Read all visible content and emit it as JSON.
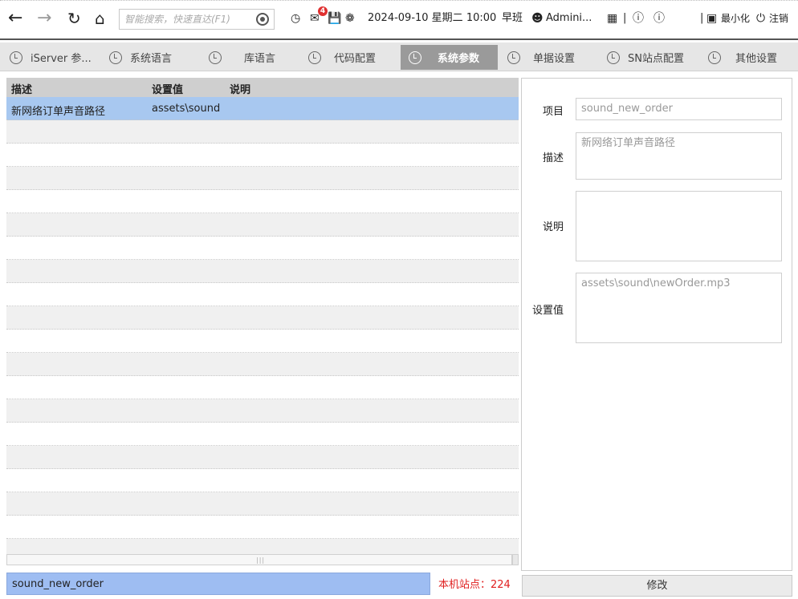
{
  "toolbar": {
    "search_placeholder": "智能搜索，快速直达(F1)",
    "mail_badge": "4",
    "datetime": "2024-09-10 星期二 10:00",
    "shift": "早班",
    "user": "Admini...",
    "minimize_label": "最小化",
    "logout_label": "注销"
  },
  "tabs": [
    {
      "label": "iServer 参...",
      "active": false
    },
    {
      "label": "系统语言",
      "active": false
    },
    {
      "label": "库语言",
      "active": false
    },
    {
      "label": "代码配置",
      "active": false
    },
    {
      "label": "系统参数",
      "active": true
    },
    {
      "label": "单据设置",
      "active": false
    },
    {
      "label": "SN站点配置",
      "active": false
    },
    {
      "label": "其他设置",
      "active": false
    }
  ],
  "grid": {
    "columns": [
      "描述",
      "设置值",
      "说明"
    ],
    "rows": [
      {
        "desc": "新网络订单声音路径",
        "value": "assets\\sound",
        "note": ""
      }
    ]
  },
  "form": {
    "item_label": "项目",
    "item_value": "sound_new_order",
    "desc_label": "描述",
    "desc_value": "新网络订单声音路径",
    "note_label": "说明",
    "note_value": "",
    "setting_label": "设置值",
    "setting_value": "assets\\sound\\newOrder.mp3"
  },
  "footer": {
    "code_value": "sound_new_order",
    "site_info": "本机站点：224",
    "modify_label": "修改"
  },
  "colors": {
    "selected_row": "#a8c8f0",
    "active_tab": "#9a9a9a",
    "code_field": "#9ebdf2",
    "site_info": "#e02020"
  }
}
